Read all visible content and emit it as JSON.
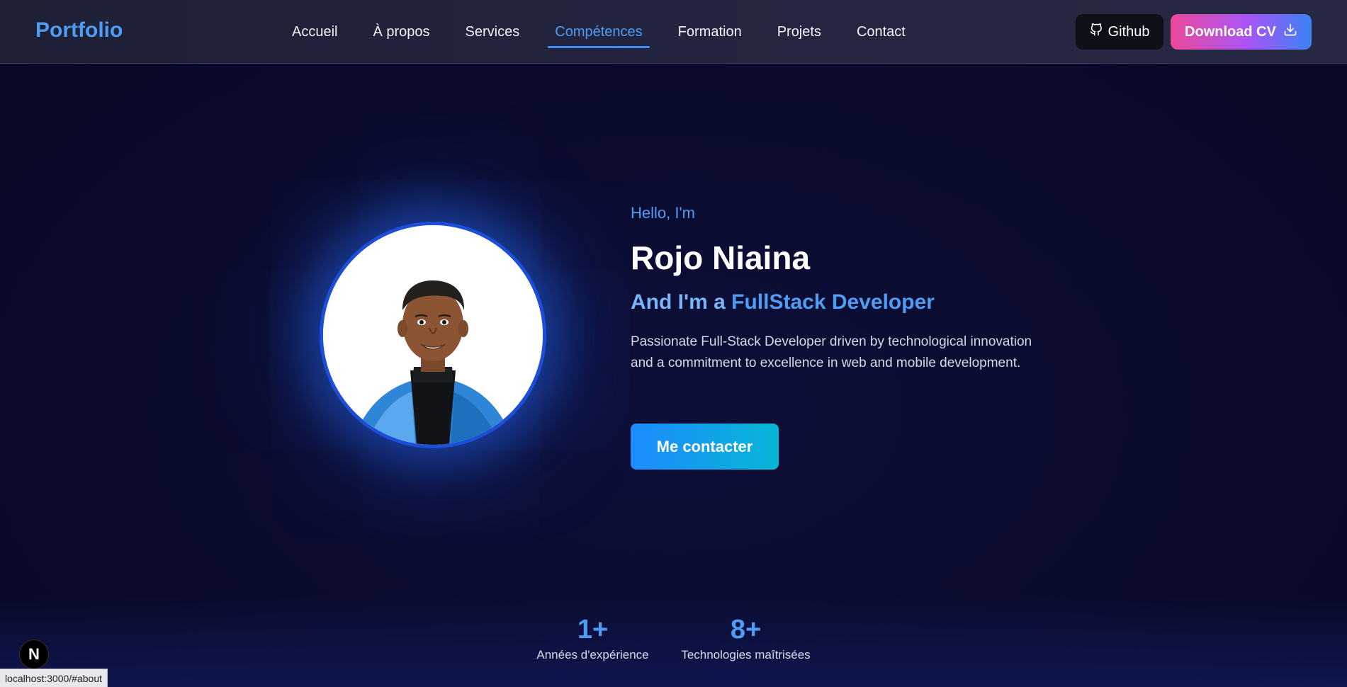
{
  "nav": {
    "logo": "Portfolio",
    "items": [
      {
        "label": "Accueil"
      },
      {
        "label": "À propos"
      },
      {
        "label": "Services"
      },
      {
        "label": "Compétences",
        "active": true
      },
      {
        "label": "Formation"
      },
      {
        "label": "Projets"
      },
      {
        "label": "Contact"
      }
    ],
    "github_label": "Github",
    "cv_label": "Download CV"
  },
  "hero": {
    "greeting": "Hello, I'm",
    "name": "Rojo Niaina",
    "role_prefix": "And I'm a ",
    "role_accent": "FullStack Developer",
    "description": "Passionate Full-Stack Developer driven by technological innovation and a commitment to excellence in web and mobile development.",
    "contact_label": "Me contacter",
    "avatar_alt": "profile photo"
  },
  "stats": [
    {
      "value": "1+",
      "label": "Années d'expérience"
    },
    {
      "value": "8+",
      "label": "Technologies maîtrisées"
    }
  ],
  "status_bar_url": "localhost:3000/#about",
  "framework_badge": "N",
  "colors": {
    "accent": "#4f9cf5",
    "background": "#0a0b2c",
    "cv_gradient_start": "#ec4899",
    "cv_gradient_end": "#3b82f6",
    "contact_gradient_start": "#1e8bff",
    "contact_gradient_end": "#06b6d4"
  }
}
